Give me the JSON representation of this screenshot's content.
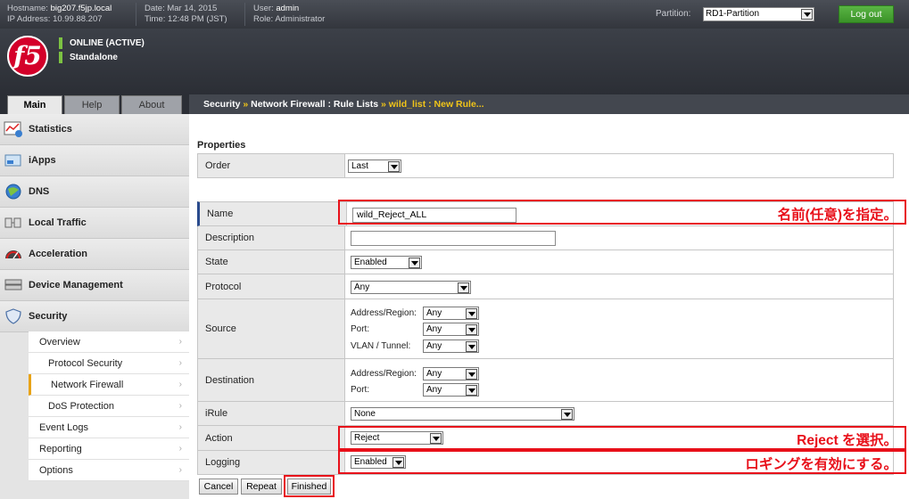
{
  "topbar": {
    "hostname_label": "Hostname:",
    "hostname": "big207.f5jp.local",
    "ip_label": "IP Address:",
    "ip": "10.99.88.207",
    "date_label": "Date:",
    "date": "Mar 14, 2015",
    "time_label": "Time:",
    "time": "12:48 PM (JST)",
    "user_label": "User:",
    "user": "admin",
    "role_label": "Role:",
    "role": "Administrator",
    "partition_label": "Partition:",
    "partition_value": "RD1-Partition",
    "logout_label": "Log out"
  },
  "header": {
    "logo_text": "f5",
    "status": "ONLINE (ACTIVE)",
    "mode": "Standalone"
  },
  "tabs": [
    "Main",
    "Help",
    "About"
  ],
  "breadcrumb": {
    "part1": "Security",
    "sep1": "»",
    "part2": "Network Firewall : Rule Lists",
    "sep2": "»",
    "part3": "wild_list : New Rule..."
  },
  "sidebar": {
    "items": [
      "Statistics",
      "iApps",
      "DNS",
      "Local Traffic",
      "Acceleration",
      "Device Management",
      "Security"
    ],
    "subitems": [
      "Overview",
      "Protocol Security",
      "Network Firewall",
      "DoS Protection",
      "Event Logs",
      "Reporting",
      "Options"
    ]
  },
  "form": {
    "section_title": "Properties",
    "order_label": "Order",
    "order_value": "Last",
    "name_label": "Name",
    "name_value": "wild_Reject_ALL",
    "description_label": "Description",
    "description_value": "",
    "state_label": "State",
    "state_value": "Enabled",
    "protocol_label": "Protocol",
    "protocol_value": "Any",
    "source_label": "Source",
    "addr_region_label": "Address/Region:",
    "port_label": "Port:",
    "vlan_label": "VLAN / Tunnel:",
    "any": "Any",
    "destination_label": "Destination",
    "irule_label": "iRule",
    "irule_value": "None",
    "action_label": "Action",
    "action_value": "Reject",
    "logging_label": "Logging",
    "logging_value": "Enabled"
  },
  "buttons": {
    "cancel": "Cancel",
    "repeat": "Repeat",
    "finished": "Finished"
  },
  "annotations": {
    "name_note": "名前(任意)を指定。",
    "action_note": "Reject を選択。",
    "logging_note": "ロギングを有効にする。"
  },
  "colors": {
    "annotation_red": "#e8101a",
    "logout_green": "#3a9228",
    "breadcrumb_highlight": "#f0c419"
  }
}
